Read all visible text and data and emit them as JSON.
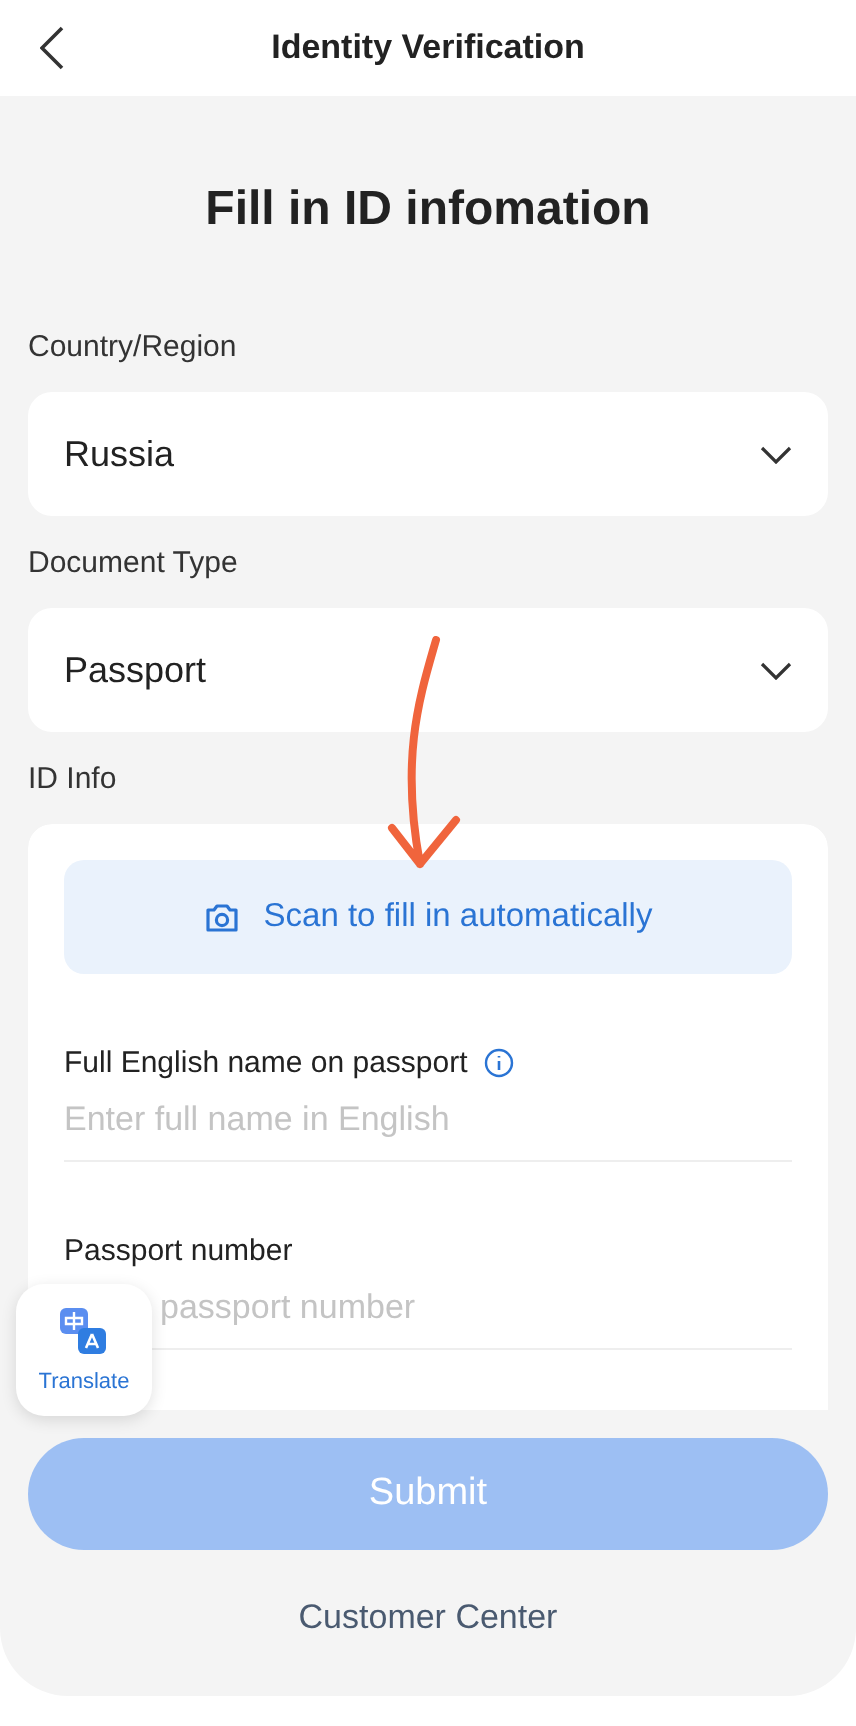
{
  "header": {
    "title": "Identity Verification"
  },
  "page_title": "Fill in ID infomation",
  "selects": [
    {
      "label": "Country/Region",
      "value": "Russia"
    },
    {
      "label": "Document Type",
      "value": "Passport"
    }
  ],
  "id_info": {
    "label": "ID Info",
    "scan_button": "Scan to fill in automatically",
    "fields": [
      {
        "label": "Full English name on passport",
        "info": true,
        "placeholder": "Enter full name in English"
      },
      {
        "label": "Passport number",
        "info": false,
        "placeholder": "passport number"
      }
    ]
  },
  "translate_button": "Translate",
  "submit": {
    "label": "Submit",
    "disabled": true
  },
  "customer_center": "Customer Center"
}
